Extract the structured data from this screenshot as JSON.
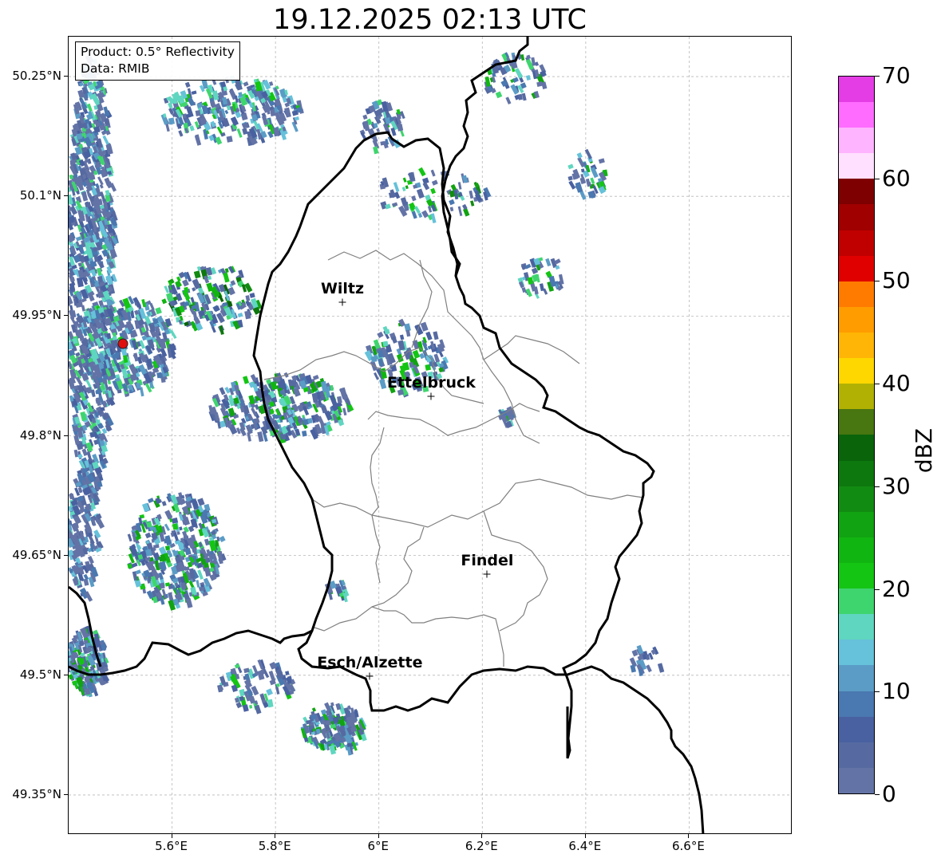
{
  "title": "19.12.2025 02:13 UTC",
  "info_box": {
    "product": "Product: 0.5° Reflectivity",
    "source": "Data: RMIB"
  },
  "axes": {
    "lon_range": [
      5.4,
      6.8
    ],
    "lat_range": [
      49.3,
      50.3
    ],
    "x_ticks": [
      {
        "value": 5.6,
        "label": "5.6°E"
      },
      {
        "value": 5.8,
        "label": "5.8°E"
      },
      {
        "value": 6.0,
        "label": "6°E"
      },
      {
        "value": 6.2,
        "label": "6.2°E"
      },
      {
        "value": 6.4,
        "label": "6.4°E"
      },
      {
        "value": 6.6,
        "label": "6.6°E"
      }
    ],
    "y_ticks": [
      {
        "value": 50.25,
        "label": "50.25°N"
      },
      {
        "value": 50.1,
        "label": "50.1°N"
      },
      {
        "value": 49.95,
        "label": "49.95°N"
      },
      {
        "value": 49.8,
        "label": "49.8°N"
      },
      {
        "value": 49.65,
        "label": "49.65°N"
      },
      {
        "value": 49.5,
        "label": "49.5°N"
      },
      {
        "value": 49.35,
        "label": "49.35°N"
      }
    ]
  },
  "cities": [
    {
      "name": "Wiltz",
      "lon": 5.931,
      "lat": 49.966
    },
    {
      "name": "Ettelbruck",
      "lon": 6.103,
      "lat": 49.848
    },
    {
      "name": "Findel",
      "lon": 6.211,
      "lat": 49.626
    },
    {
      "name": "Esch/Alzette",
      "lon": 5.984,
      "lat": 49.498
    }
  ],
  "radar_site": {
    "lon": 5.506,
    "lat": 49.914
  },
  "colorbar": {
    "unit": "dBZ",
    "min": 0,
    "max": 70,
    "tick_labels": [
      "0",
      "10",
      "20",
      "30",
      "40",
      "50",
      "60",
      "70"
    ],
    "colors": [
      "#6373a6",
      "#566aa1",
      "#4961a0",
      "#4a78b0",
      "#5a9cc6",
      "#66c1da",
      "#5fd6c0",
      "#3fd56e",
      "#14c514",
      "#11b511",
      "#11a311",
      "#128b12",
      "#0d780d",
      "#0a640a",
      "#487610",
      "#b1b104",
      "#ffd700",
      "#ffb505",
      "#ff9c00",
      "#ff7b00",
      "#e00000",
      "#c00000",
      "#a00000",
      "#7e0000",
      "#ffe0ff",
      "#ffb4ff",
      "#ff6cff",
      "#e53de5"
    ]
  }
}
